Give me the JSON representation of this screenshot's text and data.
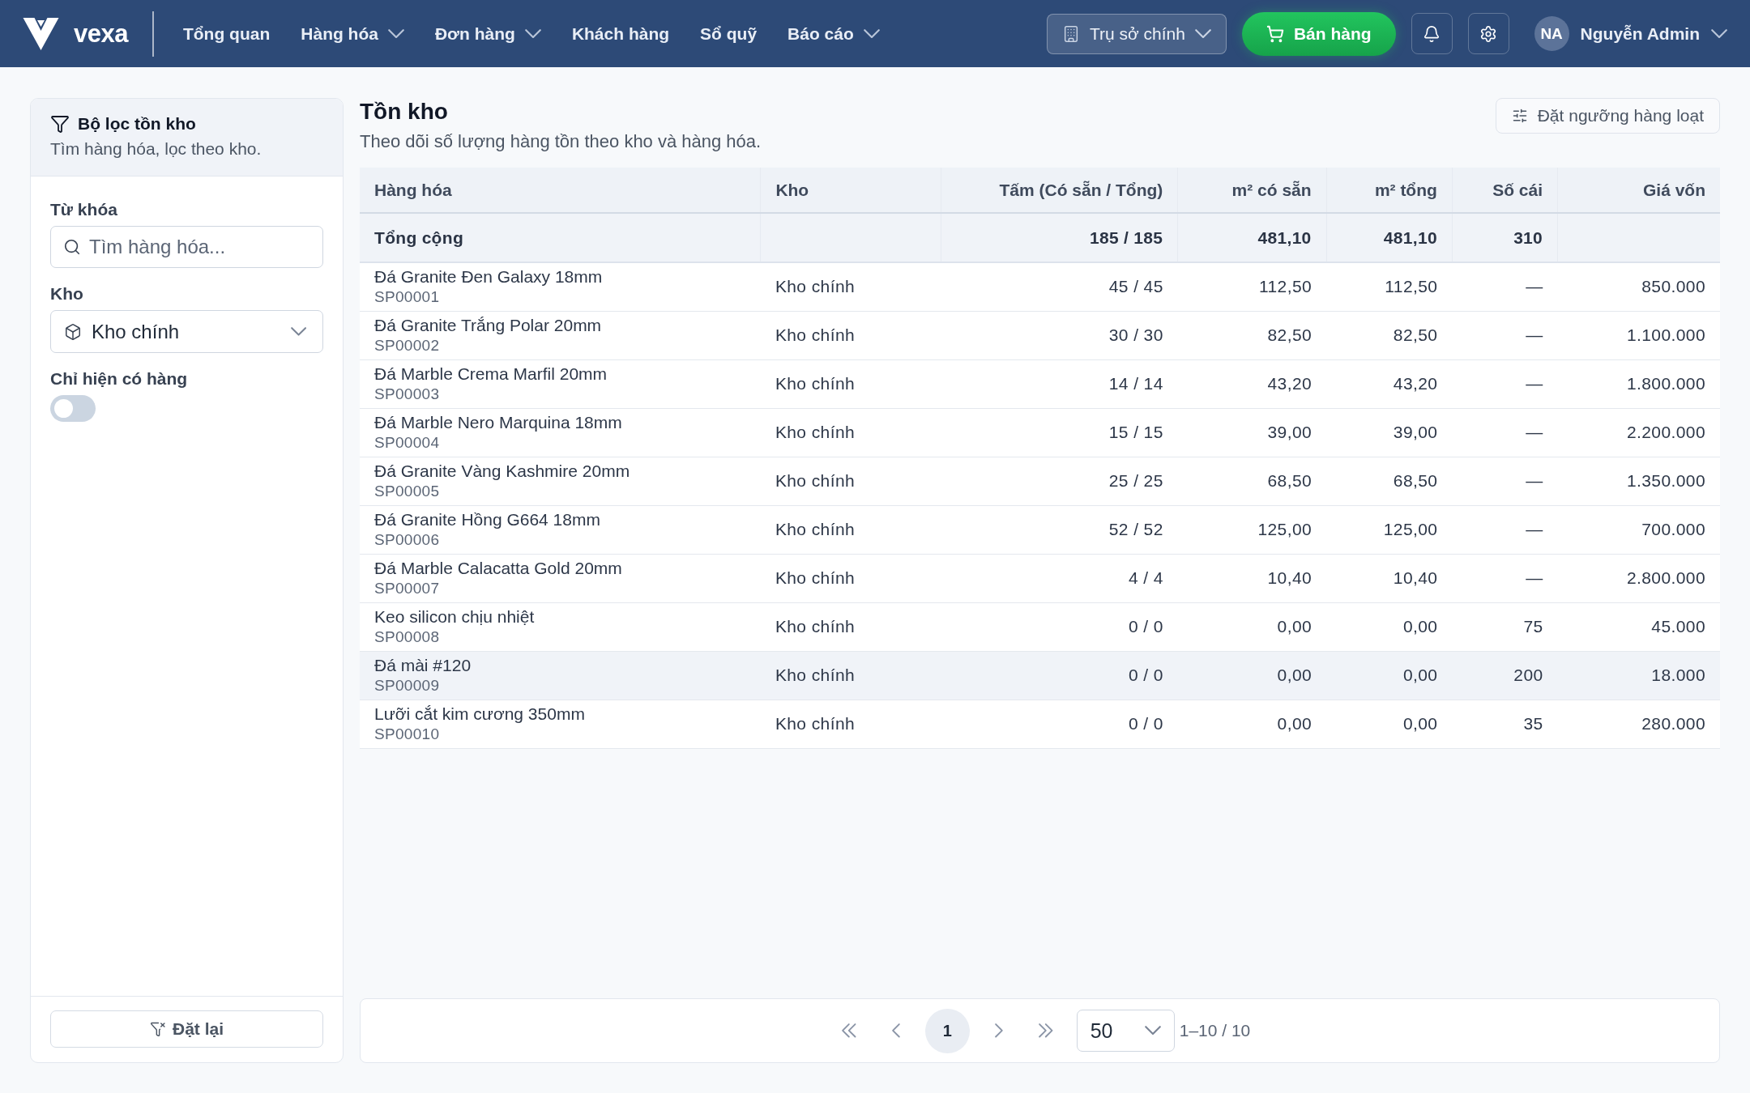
{
  "nav": {
    "logo": "vexa",
    "items": [
      {
        "label": "Tổng quan",
        "dropdown": false
      },
      {
        "label": "Hàng hóa",
        "dropdown": true
      },
      {
        "label": "Đơn hàng",
        "dropdown": true
      },
      {
        "label": "Khách hàng",
        "dropdown": false
      },
      {
        "label": "Sổ quỹ",
        "dropdown": false
      },
      {
        "label": "Báo cáo",
        "dropdown": true
      }
    ],
    "branch": "Trụ sở chính",
    "sell_button": "Bán hàng",
    "user": {
      "initials": "NA",
      "name": "Nguyễn Admin"
    }
  },
  "filter_panel": {
    "title": "Bộ lọc tồn kho",
    "subtitle": "Tìm hàng hóa, lọc theo kho.",
    "keyword": {
      "label": "Từ khóa",
      "placeholder": "Tìm hàng hóa..."
    },
    "warehouse": {
      "label": "Kho",
      "value": "Kho chính"
    },
    "in_stock_only": {
      "label": "Chỉ hiện có hàng",
      "on": false
    },
    "reset_button": "Đặt lại"
  },
  "page": {
    "title": "Tồn kho",
    "subtitle": "Theo dõi số lượng hàng tồn theo kho và hàng hóa.",
    "bulk_threshold_button": "Đặt ngưỡng hàng loạt"
  },
  "table": {
    "columns": [
      "Hàng hóa",
      "Kho",
      "Tấm (Có sẵn / Tổng)",
      "m² có sẵn",
      "m² tổng",
      "Số cái",
      "Giá vốn"
    ],
    "total_row": {
      "label": "Tổng cộng",
      "sheets": "185 / 185",
      "m2_available": "481,10",
      "m2_total": "481,10",
      "pieces": "310"
    },
    "rows": [
      {
        "name": "Đá Granite Đen Galaxy 18mm",
        "code": "SP00001",
        "warehouse": "Kho chính",
        "sheets": "45 / 45",
        "m2_available": "112,50",
        "m2_total": "112,50",
        "pieces": "—",
        "cost": "850.000",
        "highlighted": false
      },
      {
        "name": "Đá Granite Trắng Polar 20mm",
        "code": "SP00002",
        "warehouse": "Kho chính",
        "sheets": "30 / 30",
        "m2_available": "82,50",
        "m2_total": "82,50",
        "pieces": "—",
        "cost": "1.100.000",
        "highlighted": false
      },
      {
        "name": "Đá Marble Crema Marfil 20mm",
        "code": "SP00003",
        "warehouse": "Kho chính",
        "sheets": "14 / 14",
        "m2_available": "43,20",
        "m2_total": "43,20",
        "pieces": "—",
        "cost": "1.800.000",
        "highlighted": false
      },
      {
        "name": "Đá Marble Nero Marquina 18mm",
        "code": "SP00004",
        "warehouse": "Kho chính",
        "sheets": "15 / 15",
        "m2_available": "39,00",
        "m2_total": "39,00",
        "pieces": "—",
        "cost": "2.200.000",
        "highlighted": false
      },
      {
        "name": "Đá Granite Vàng Kashmire 20mm",
        "code": "SP00005",
        "warehouse": "Kho chính",
        "sheets": "25 / 25",
        "m2_available": "68,50",
        "m2_total": "68,50",
        "pieces": "—",
        "cost": "1.350.000",
        "highlighted": false
      },
      {
        "name": "Đá Granite Hồng G664 18mm",
        "code": "SP00006",
        "warehouse": "Kho chính",
        "sheets": "52 / 52",
        "m2_available": "125,00",
        "m2_total": "125,00",
        "pieces": "—",
        "cost": "700.000",
        "highlighted": false
      },
      {
        "name": "Đá Marble Calacatta Gold 20mm",
        "code": "SP00007",
        "warehouse": "Kho chính",
        "sheets": "4 / 4",
        "m2_available": "10,40",
        "m2_total": "10,40",
        "pieces": "—",
        "cost": "2.800.000",
        "highlighted": false
      },
      {
        "name": "Keo silicon chịu nhiệt",
        "code": "SP00008",
        "warehouse": "Kho chính",
        "sheets": "0 / 0",
        "m2_available": "0,00",
        "m2_total": "0,00",
        "pieces": "75",
        "cost": "45.000",
        "highlighted": false
      },
      {
        "name": "Đá mài #120",
        "code": "SP00009",
        "warehouse": "Kho chính",
        "sheets": "0 / 0",
        "m2_available": "0,00",
        "m2_total": "0,00",
        "pieces": "200",
        "cost": "18.000",
        "highlighted": true
      },
      {
        "name": "Lưỡi cắt kim cương 350mm",
        "code": "SP00010",
        "warehouse": "Kho chính",
        "sheets": "0 / 0",
        "m2_available": "0,00",
        "m2_total": "0,00",
        "pieces": "35",
        "cost": "280.000",
        "highlighted": false
      }
    ]
  },
  "pagination": {
    "pages": [
      {
        "label": "1",
        "selected": true
      }
    ],
    "page_size": "50",
    "range": "1–10 / 10"
  }
}
